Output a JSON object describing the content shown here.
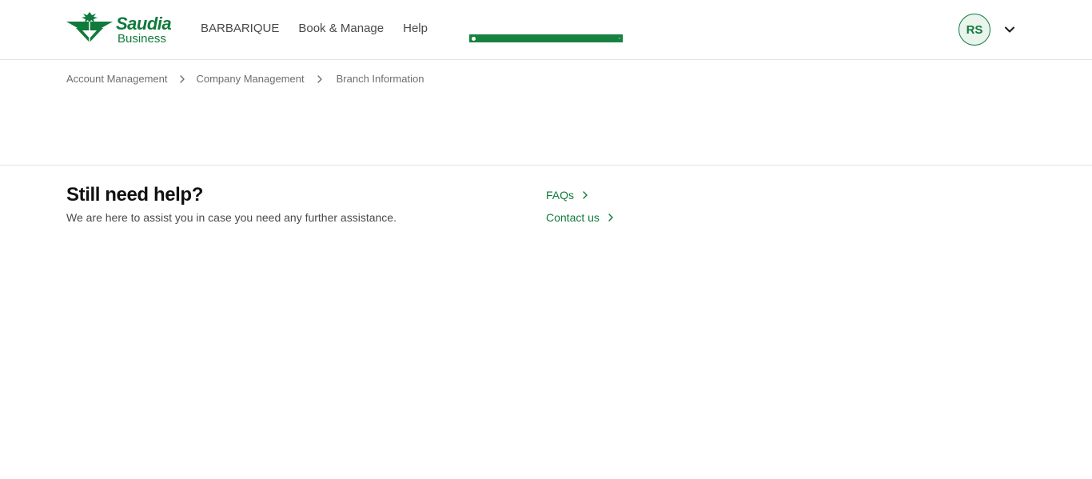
{
  "brand": {
    "name": "Saudia",
    "sub": "Business",
    "color": "#0f7a3c"
  },
  "nav": {
    "items": [
      {
        "label": "BARBARIQUE"
      },
      {
        "label": "Book & Manage"
      },
      {
        "label": "Help"
      }
    ]
  },
  "toast": {
    "text": "",
    "close": "×",
    "color": "#17823f"
  },
  "user": {
    "initials": "RS",
    "menu_icon": "chevron-down-icon"
  },
  "breadcrumb": {
    "items": [
      {
        "label": "Account Management"
      },
      {
        "label": "Company Management"
      },
      {
        "label": "Branch Information"
      }
    ],
    "separator_icon": "chevron-right-icon"
  },
  "help": {
    "title": "Still need help?",
    "subtitle": "We are here to assist you in case you need any further assistance.",
    "links": [
      {
        "label": "FAQs",
        "icon": "chevron-right-icon"
      },
      {
        "label": "Contact us",
        "icon": "chevron-right-icon"
      }
    ]
  }
}
